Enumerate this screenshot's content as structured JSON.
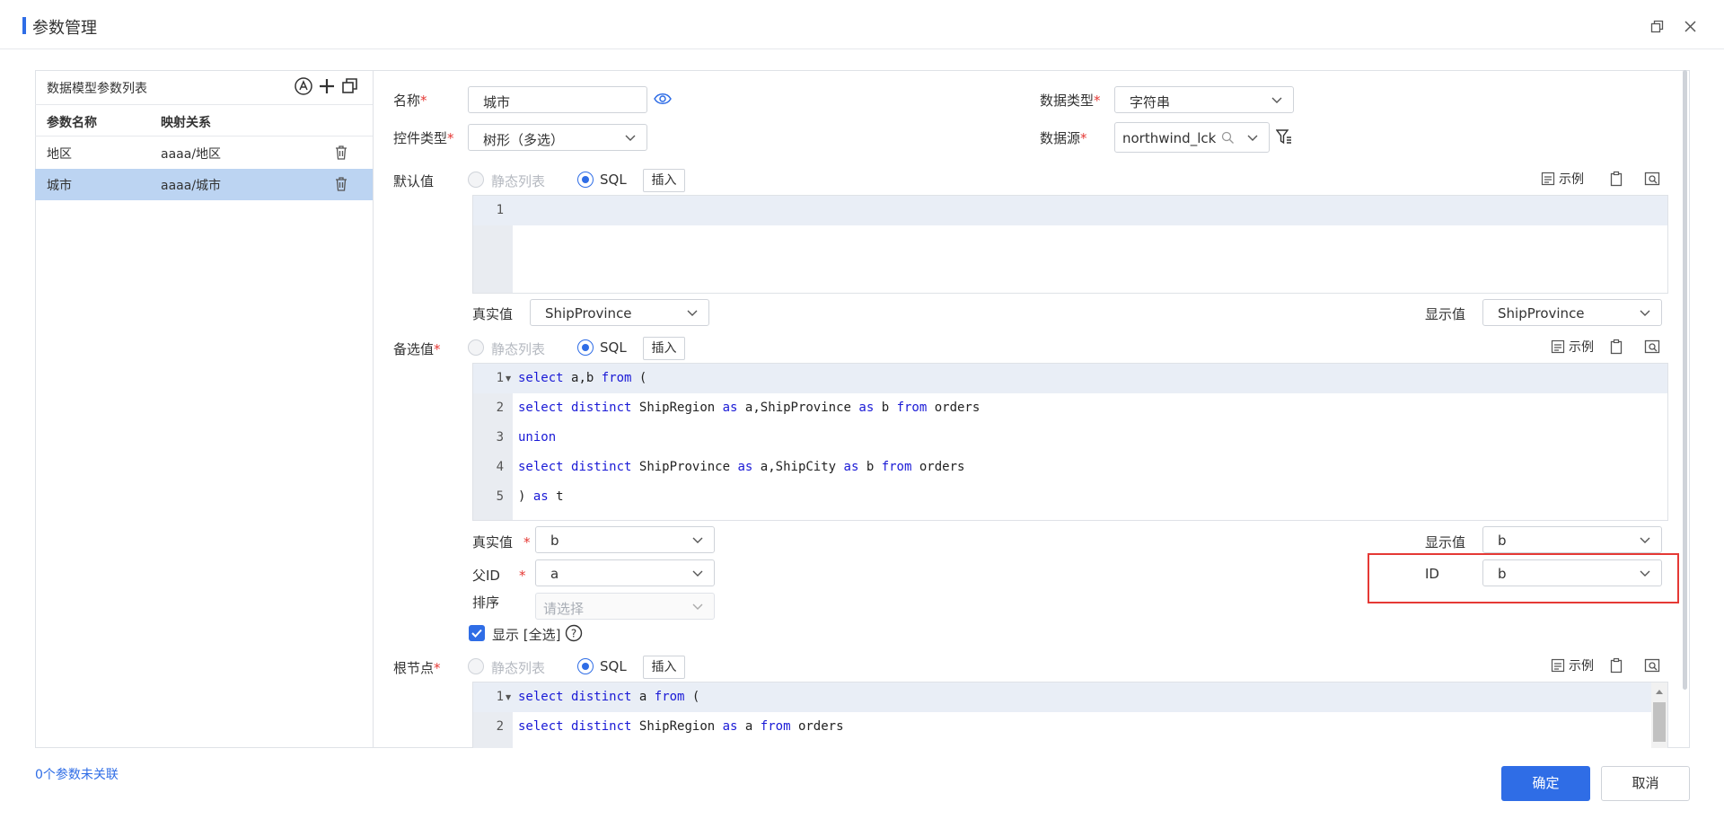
{
  "dialog": {
    "title": "参数管理"
  },
  "left_panel": {
    "title": "数据模型参数列表",
    "columns": [
      "参数名称",
      "映射关系"
    ],
    "rows": [
      {
        "name": "地区",
        "mapping": "aaaa/地区",
        "selected": false
      },
      {
        "name": "城市",
        "mapping": "aaaa/城市",
        "selected": true
      }
    ]
  },
  "form": {
    "name": {
      "label": "名称",
      "value": "城市"
    },
    "data_type": {
      "label": "数据类型",
      "value": "字符串"
    },
    "control_type": {
      "label": "控件类型",
      "value": "树形（多选）"
    },
    "datasource": {
      "label": "数据源",
      "value": "northwind_lck"
    },
    "default": {
      "label": "默认值",
      "radio_static": "静态列表",
      "radio_sql": "SQL",
      "insert": "插入",
      "example": "示例",
      "line_numbers": [
        "1"
      ],
      "real_label": "真实值",
      "real_value": "ShipProvince",
      "display_label": "显示值",
      "display_value": "ShipProvince"
    },
    "candidate": {
      "label": "备选值",
      "radio_static": "静态列表",
      "radio_sql": "SQL",
      "insert": "插入",
      "example": "示例",
      "line_numbers": [
        "1",
        "2",
        "3",
        "4",
        "5"
      ],
      "code": [
        "select a,b from (",
        "select distinct ShipRegion as a,ShipProvince as b from orders",
        "union",
        "select distinct ShipProvince as a,ShipCity as b from orders",
        ") as t"
      ],
      "real_label": "真实值",
      "real_value": "b",
      "display_label": "显示值",
      "display_value": "b",
      "parent_label": "父ID",
      "parent_value": "a",
      "id_label": "ID",
      "id_value": "b",
      "sort_label": "排序",
      "sort_placeholder": "请选择",
      "show_all_label": "显示 [全选]"
    },
    "root": {
      "label": "根节点",
      "radio_static": "静态列表",
      "radio_sql": "SQL",
      "insert": "插入",
      "example": "示例",
      "line_numbers": [
        "1",
        "2"
      ],
      "code": [
        "select distinct a from (",
        "select distinct ShipRegion as a from orders"
      ]
    }
  },
  "footer": {
    "unlinked": "0个参数未关联",
    "ok": "确定",
    "cancel": "取消"
  },
  "colors": {
    "accent": "#2f6de6",
    "required": "#e53935",
    "selected_row": "#bcd4f2",
    "keyword": "#1a1ad6"
  }
}
